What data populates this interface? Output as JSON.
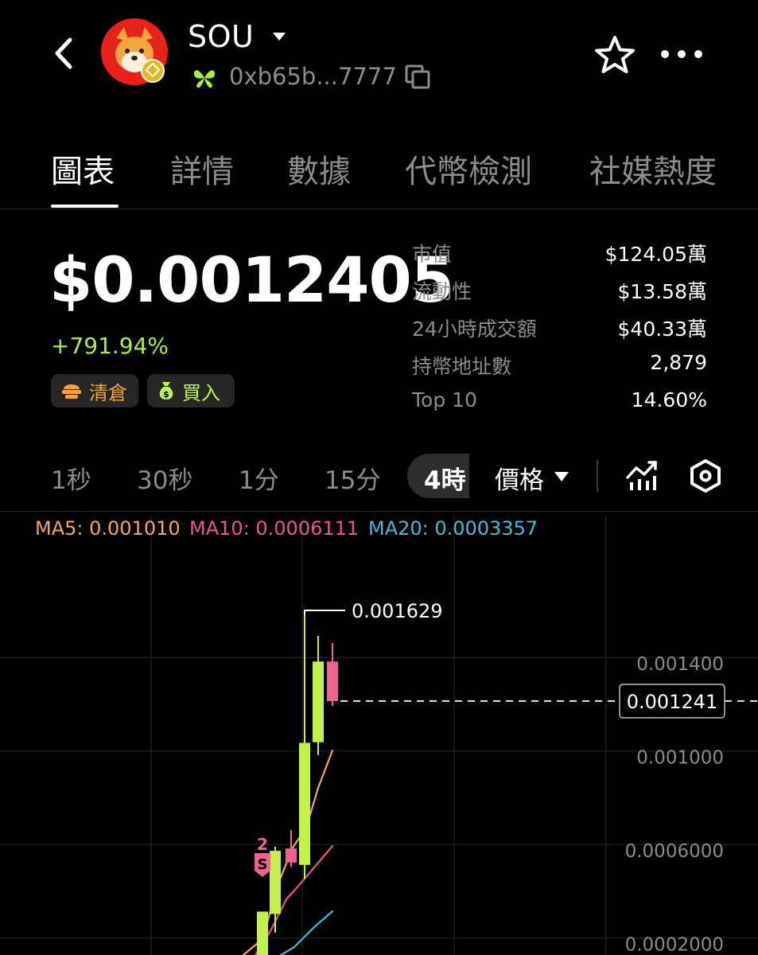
{
  "header": {
    "token_name": "SOU",
    "address": "0xb65b...7777",
    "icons": [
      "back-arrow-icon",
      "token-avatar",
      "chevron-down-icon",
      "chain-butterfly-icon",
      "copy-icon",
      "star-icon",
      "more-icon"
    ]
  },
  "tabs": [
    {
      "label": "圖表",
      "active": true
    },
    {
      "label": "詳情",
      "active": false
    },
    {
      "label": "數據",
      "active": false
    },
    {
      "label": "代幣檢測",
      "active": false
    },
    {
      "label": "社媒熱度",
      "active": false
    }
  ],
  "price": {
    "value": "$0.0012405",
    "change": "+791.94%",
    "sell_label": "清倉",
    "buy_label": "買入"
  },
  "stats": [
    {
      "label": "市值",
      "value": "$124.05萬"
    },
    {
      "label": "流動性",
      "value": "$13.58萬"
    },
    {
      "label": "24小時成交額",
      "value": "$40.33萬"
    },
    {
      "label": "持幣地址數",
      "value": "2,879"
    },
    {
      "label": "Top 10",
      "value": "14.60%"
    }
  ],
  "intervals": [
    {
      "label": "1秒",
      "selected": false
    },
    {
      "label": "30秒",
      "selected": false
    },
    {
      "label": "1分",
      "selected": false
    },
    {
      "label": "15分",
      "selected": false
    },
    {
      "label": "4時",
      "selected": true
    }
  ],
  "metric_selector": "價格",
  "ma_legend": [
    {
      "text": "MA5: 0.001010",
      "color": "#f0a75f"
    },
    {
      "text": "MA10: 0.0006111",
      "color": "#e8578a"
    },
    {
      "text": "MA20: 0.0003357",
      "color": "#4ab8d8"
    }
  ],
  "colors": {
    "up": "#c2f24a",
    "down": "#f06292",
    "accent_green": "#a9ef3b",
    "ma5": "#f0a75f",
    "ma10": "#e8578a",
    "ma20": "#4ab8d8"
  },
  "chart_data": {
    "type": "candlestick",
    "interval": "4時",
    "y_ticks": [
      0.0002,
      0.0006,
      0.001,
      0.0014
    ],
    "y_tick_labels": [
      "0.0002000",
      "0.0006000",
      "0.001000",
      "0.001400"
    ],
    "ylim": [
      0.00011,
      0.00168
    ],
    "current_price": 0.001241,
    "current_price_label": "0.001241",
    "high_marker": 0.001629,
    "high_marker_label": "0.001629",
    "trade_marker": {
      "label": "S",
      "count": "2",
      "candle_index": 0
    },
    "candles": [
      {
        "open": 0.00014,
        "high": 0.00034,
        "low": 0.00011,
        "close": 0.00034
      },
      {
        "open": 0.00033,
        "high": 0.000618,
        "low": 0.00025,
        "close": 0.0006
      },
      {
        "open": 0.00061,
        "high": 0.00069,
        "low": 0.00053,
        "close": 0.00055
      },
      {
        "open": 0.00054,
        "high": 0.001629,
        "low": 0.00048,
        "close": 0.001062
      },
      {
        "open": 0.001065,
        "high": 0.00152,
        "low": 0.00101,
        "close": 0.00141
      },
      {
        "open": 0.00141,
        "high": 0.00149,
        "low": 0.00122,
        "close": 0.001241
      }
    ],
    "ma5": [
      [
        0.00012,
        0.0
      ],
      [
        0.00045,
        0.0
      ],
      [
        0.00072,
        0.0
      ],
      [
        0.00101,
        0.0
      ]
    ],
    "ma10": [
      [
        6e-05,
        0.0
      ],
      [
        0.00028,
        0.0
      ],
      [
        0.00061,
        0.0
      ]
    ],
    "ma20": [
      [
        1e-05,
        0.0
      ],
      [
        0.00019,
        0.0
      ],
      [
        0.00034,
        0.0
      ]
    ]
  }
}
